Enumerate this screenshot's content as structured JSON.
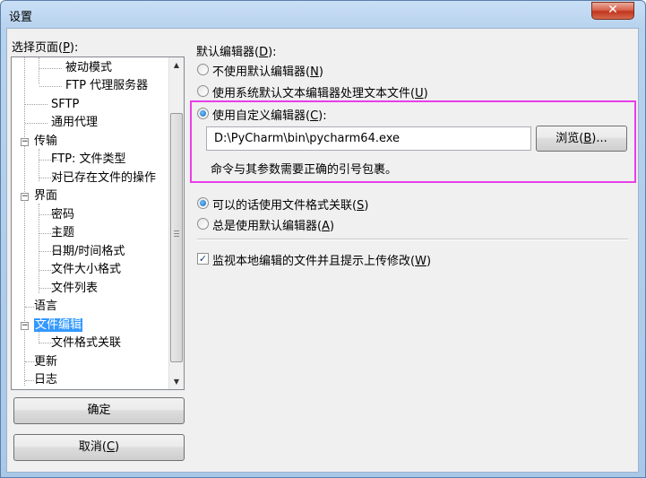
{
  "window": {
    "title": "设置",
    "close_glyph": "✕"
  },
  "left": {
    "label": "选择页面(",
    "label_key": "P",
    "label_tail": "):",
    "tree": [
      {
        "text": "被动模式"
      },
      {
        "text": "FTP 代理服务器"
      },
      {
        "text": "SFTP"
      },
      {
        "text": "通用代理"
      },
      {
        "text": "传输"
      },
      {
        "text": "FTP: 文件类型"
      },
      {
        "text": "对已存在文件的操作"
      },
      {
        "text": "界面"
      },
      {
        "text": "密码"
      },
      {
        "text": "主题"
      },
      {
        "text": "日期/时间格式"
      },
      {
        "text": "文件大小格式"
      },
      {
        "text": "文件列表"
      },
      {
        "text": "语言"
      },
      {
        "text": "文件编辑"
      },
      {
        "text": "文件格式关联"
      },
      {
        "text": "更新"
      },
      {
        "text": "日志"
      }
    ]
  },
  "buttons": {
    "ok": "确定",
    "cancel_pre": "取消(",
    "cancel_key": "C",
    "cancel_post": ")"
  },
  "editor": {
    "heading_pre": "默认编辑器(",
    "heading_key": "D",
    "heading_post": "):",
    "opt_none_pre": "不使用默认编辑器(",
    "opt_none_key": "N",
    "opt_none_post": ")",
    "opt_system_pre": "使用系统默认文本编辑器处理文本文件(",
    "opt_system_key": "U",
    "opt_system_post": ")",
    "opt_custom_pre": "使用自定义编辑器(",
    "opt_custom_key": "C",
    "opt_custom_post": "):",
    "path_value": "D:\\PyCharm\\bin\\pycharm64.exe",
    "browse_pre": "浏览(",
    "browse_key": "B",
    "browse_post": ")...",
    "hint": "命令与其参数需要正确的引号包裹。",
    "opt_assoc_pre": "可以的话使用文件格式关联(",
    "opt_assoc_key": "S",
    "opt_assoc_post": ")",
    "opt_always_pre": "总是使用默认编辑器(",
    "opt_always_key": "A",
    "opt_always_post": ")",
    "watch_pre": "监视本地编辑的文件并且提示上传修改(",
    "watch_key": "W",
    "watch_post": ")",
    "selected_radio_1": "custom",
    "selected_radio_2": "assoc",
    "watch_checked": true,
    "highlight_color": "#e83ee8"
  }
}
